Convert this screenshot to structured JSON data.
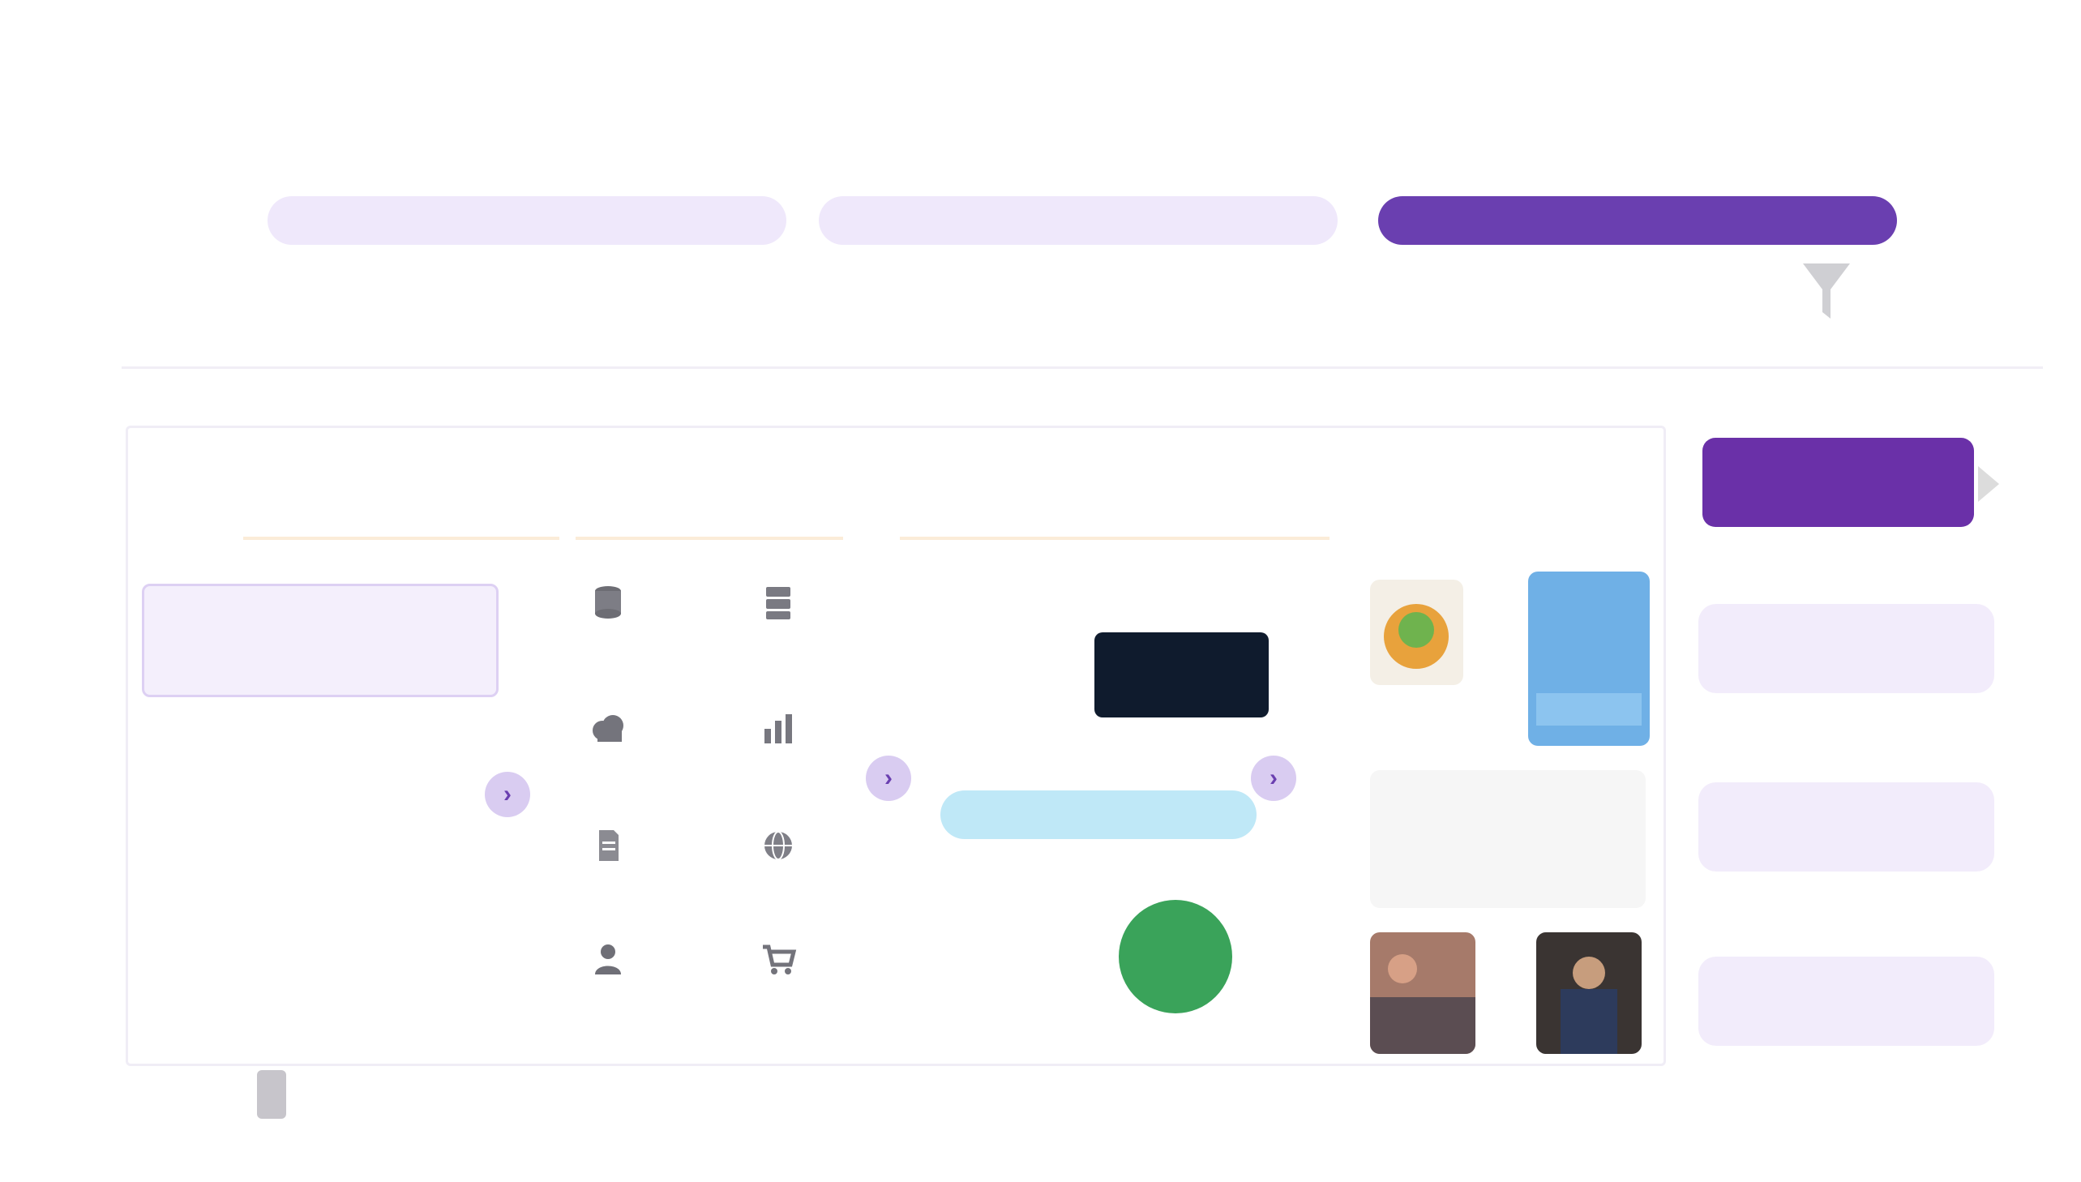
{
  "brand": {
    "logo_text": "",
    "logo_color": "#e0485a"
  },
  "steps": {
    "tabs": [
      {
        "label": "",
        "state": "idle"
      },
      {
        "label": "",
        "state": "idle"
      },
      {
        "label": "",
        "state": "active"
      }
    ],
    "subs": [
      "",
      "",
      ""
    ],
    "accent": "#6a3fb0"
  },
  "notice": "",
  "flow": {
    "columns": [
      {
        "heading": ""
      },
      {
        "heading": ""
      },
      {
        "heading": ""
      },
      {
        "heading": ""
      }
    ],
    "sub_steps": [
      {
        "label": "",
        "selected": true
      },
      {
        "label": "",
        "selected": false
      },
      {
        "label": "",
        "selected": false
      },
      {
        "label": "",
        "selected": false
      }
    ],
    "data_sources": [
      {
        "icon": "database-icon",
        "label": ""
      },
      {
        "icon": "server-icon",
        "label": ""
      },
      {
        "icon": "cloud-icon",
        "label": ""
      },
      {
        "icon": "chart-icon",
        "label": ""
      },
      {
        "icon": "document-icon",
        "label": ""
      },
      {
        "icon": "globe-icon",
        "label": ""
      },
      {
        "icon": "user-icon",
        "label": ""
      },
      {
        "icon": "cart-icon",
        "label": ""
      }
    ],
    "ecosystem_logos": [
      {
        "name": "",
        "color": "#d9d9d9"
      },
      {
        "name": "",
        "color": "#0f1b2d"
      },
      {
        "name": "",
        "color": "#8fd4ef"
      },
      {
        "name": "",
        "color": "#d9d9d9"
      },
      {
        "name": "",
        "color": "#3aa35a"
      }
    ]
  },
  "actions": {
    "primary": {
      "label": "",
      "color": "#6a30a8"
    },
    "secondary": [
      {
        "label": ""
      },
      {
        "label": ""
      },
      {
        "label": ""
      }
    ]
  },
  "footer": {
    "logo_text": ""
  }
}
